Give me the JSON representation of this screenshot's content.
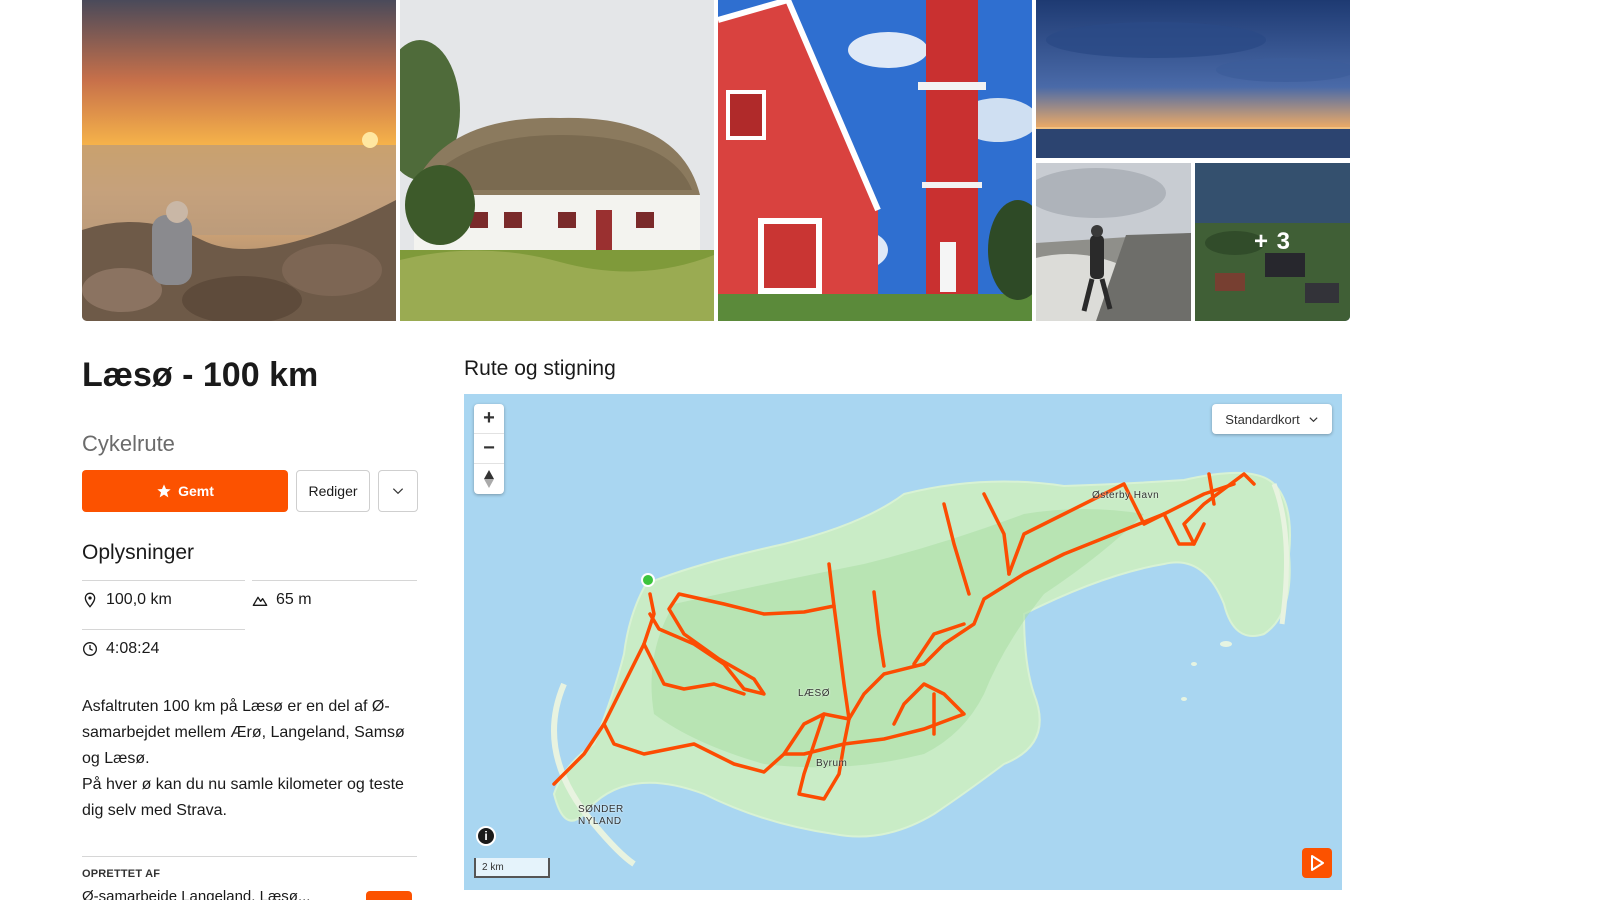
{
  "gallery": {
    "more_count": "+ 3"
  },
  "route": {
    "title": "Læsø - 100 km",
    "type": "Cykelrute",
    "saved_label": "Gemt",
    "edit_label": "Rediger"
  },
  "info": {
    "heading": "Oplysninger",
    "distance": "100,0 km",
    "elevation": "65 m",
    "time": "4:08:24"
  },
  "description": {
    "line1": "Asfaltruten 100 km på Læsø er en del af Ø-samarbejdet mellem Ærø, Langeland, Samsø og Læsø.",
    "line2": "På hver ø kan du nu samle kilometer og teste dig selv med Strava."
  },
  "creator": {
    "label": "OPRETTET AF",
    "name": "Ø-samarbejde Langeland, Læsø..."
  },
  "map": {
    "heading": "Rute og stigning",
    "map_type": "Standardkort",
    "scale_label": "2 km",
    "labels": {
      "osterby": "Østerby Havn",
      "laeso": "LÆSØ",
      "byrum": "Byrum",
      "sonder1": "SØNDER",
      "sonder2": "NYLAND"
    },
    "route_color": "#fc4c02",
    "land_color": "#c9ecc6",
    "water_color": "#a9d6f1"
  },
  "colors": {
    "accent": "#fc5200"
  }
}
